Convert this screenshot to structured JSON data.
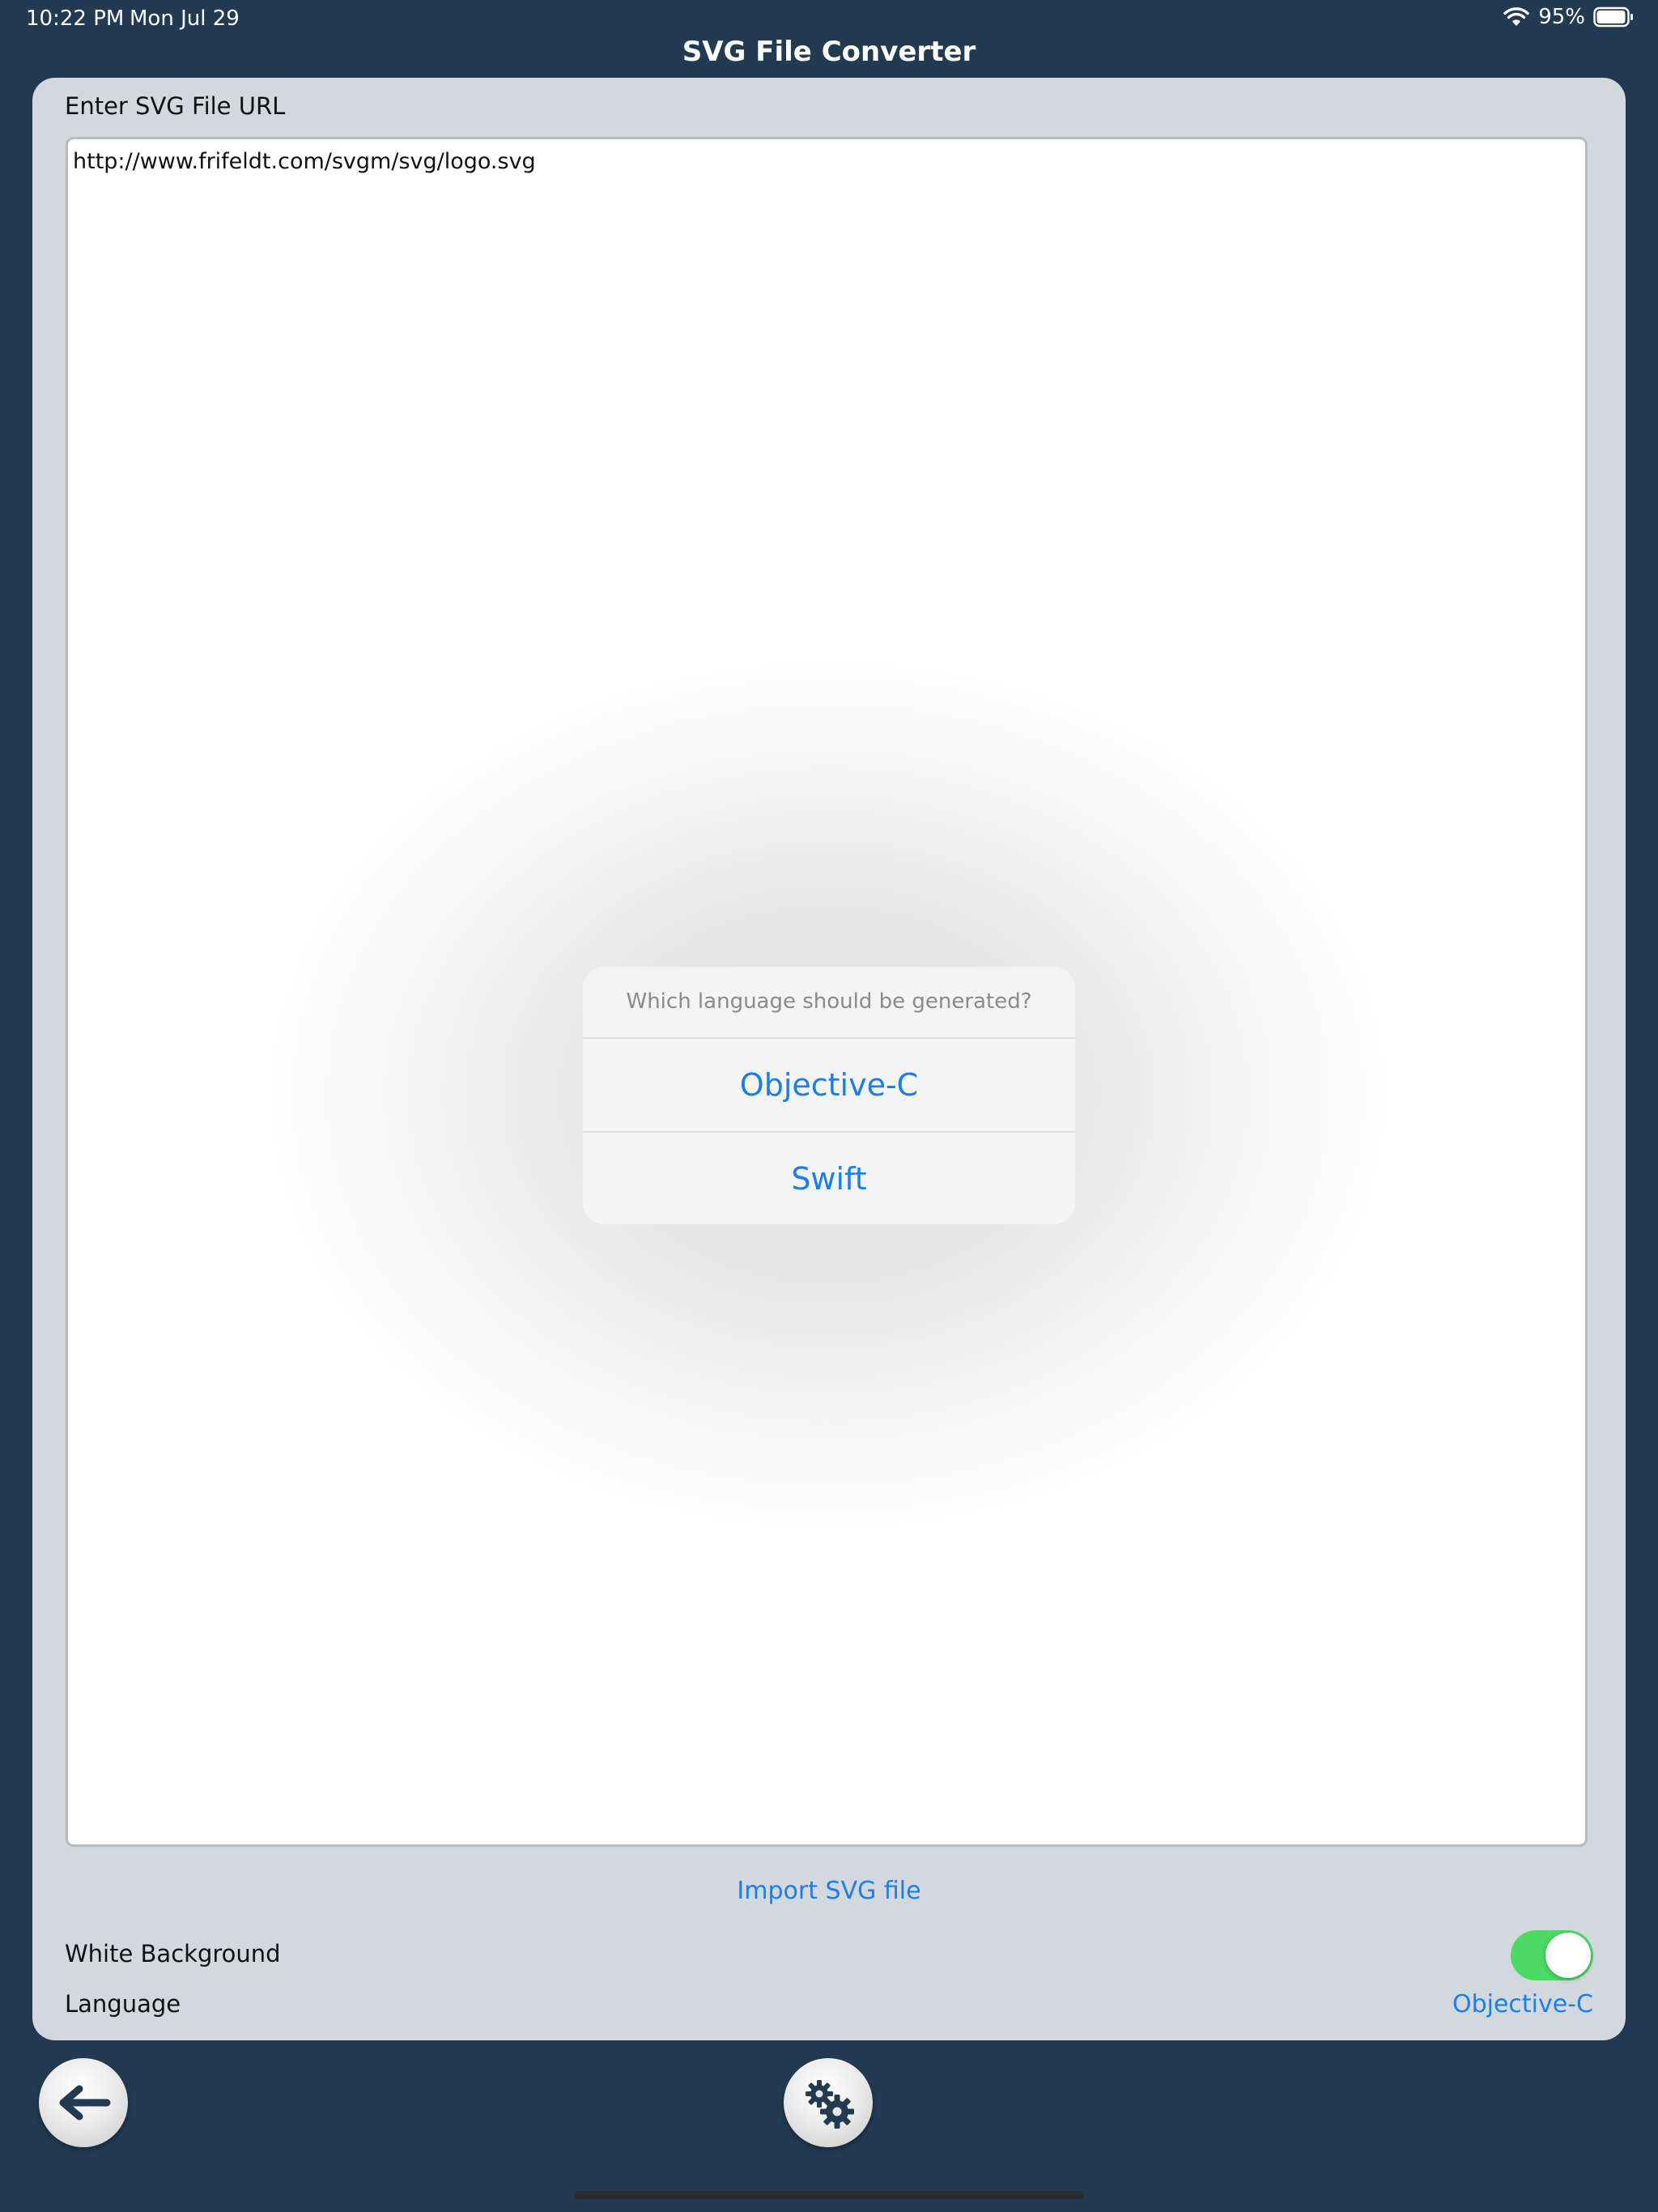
{
  "status_bar": {
    "time": "10:22 PM",
    "date": "Mon Jul 29",
    "battery": "95%",
    "icons": [
      "wifi-icon",
      "battery-icon"
    ]
  },
  "nav": {
    "title": "SVG File Converter"
  },
  "form": {
    "url_label": "Enter SVG File URL",
    "url_value": "http://www.frifeldt.com/svgm/svg/logo.svg",
    "import_label": "Import SVG file",
    "white_background_label": "White Background",
    "white_background_on": true,
    "language_label": "Language",
    "language_value": "Objective-C"
  },
  "dialog": {
    "message": "Which language should be generated?",
    "options": [
      "Objective-C",
      "Swift"
    ]
  },
  "toolbar": {
    "icons": [
      "back-arrow-icon",
      "gears-icon"
    ]
  },
  "colors": {
    "background": "#233b52",
    "panel": "#d3d8dc",
    "accent": "#1a7ef0",
    "toggle_on": "#4cd964"
  }
}
